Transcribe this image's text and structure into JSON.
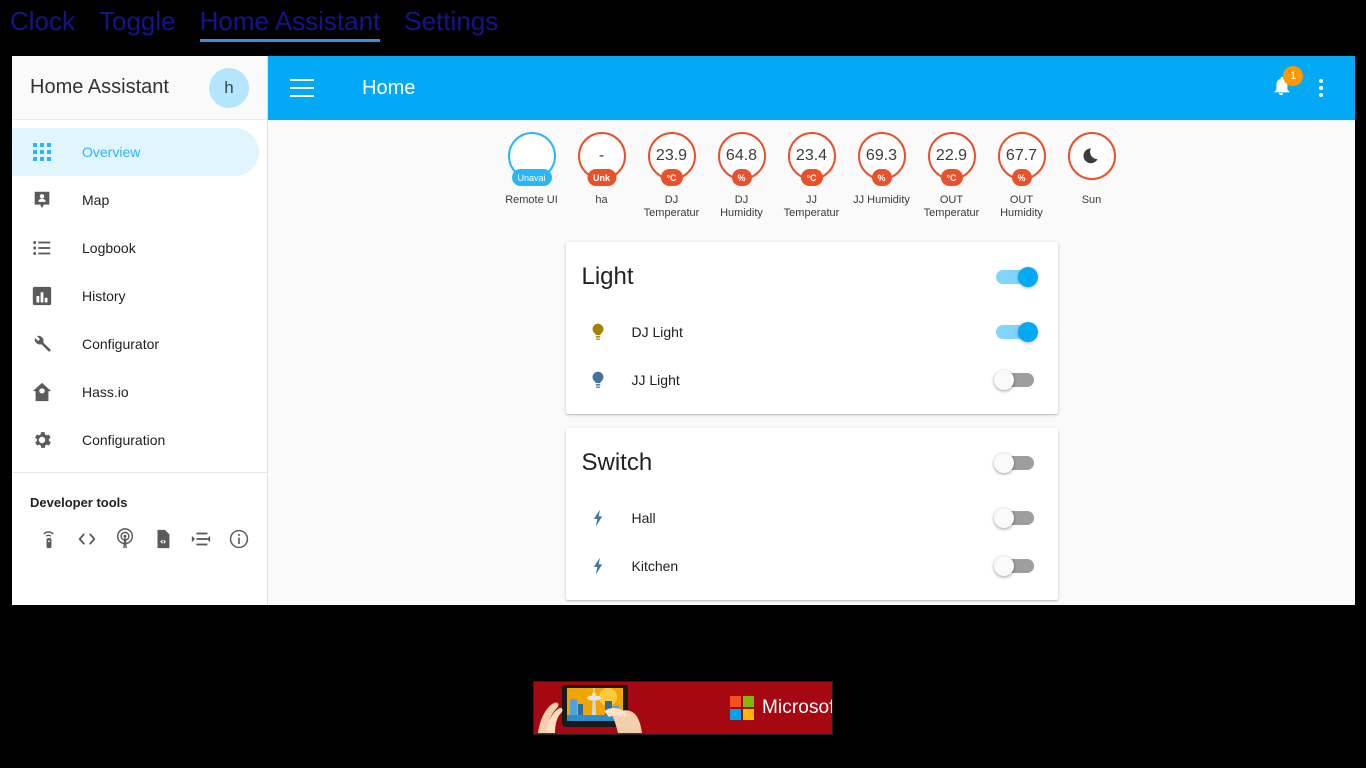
{
  "topnav": {
    "items": [
      {
        "label": "Clock",
        "active": false
      },
      {
        "label": "Toggle",
        "active": false
      },
      {
        "label": "Home Assistant",
        "active": true
      },
      {
        "label": "Settings",
        "active": false
      }
    ],
    "accent_underline": "#3d8fd6",
    "text_color": "#14148c"
  },
  "sidebar": {
    "title": "Home Assistant",
    "avatar_initial": "h",
    "items": [
      {
        "label": "Overview",
        "icon": "grid-icon",
        "active": true
      },
      {
        "label": "Map",
        "icon": "map-marker-icon",
        "active": false
      },
      {
        "label": "Logbook",
        "icon": "list-icon",
        "active": false
      },
      {
        "label": "History",
        "icon": "chart-bar-icon",
        "active": false
      },
      {
        "label": "Configurator",
        "icon": "wrench-icon",
        "active": false
      },
      {
        "label": "Hass.io",
        "icon": "home-leaf-icon",
        "active": false
      },
      {
        "label": "Configuration",
        "icon": "gear-icon",
        "active": false
      }
    ],
    "devtools_title": "Developer tools",
    "devtools_icons": [
      "remote-icon",
      "code-icon",
      "broadcast-icon",
      "template-file-icon",
      "services-icon",
      "info-icon"
    ]
  },
  "toolbar": {
    "menu_icon": "hamburger-icon",
    "title": "Home",
    "notification_icon": "bell-icon",
    "notification_count": "1",
    "notification_badge_color": "#ff9800",
    "overflow_icon": "kebab-menu-icon",
    "background": "#03a9f4"
  },
  "badges": [
    {
      "value": "",
      "pill": "Unavai",
      "label": "Remote UI",
      "color": "blue",
      "icon": ""
    },
    {
      "value": "-",
      "pill": "Unk",
      "label": "ha",
      "color": "orange",
      "icon": ""
    },
    {
      "value": "23.9",
      "pill": "°C",
      "label": "DJ Temperature",
      "color": "orange",
      "icon": ""
    },
    {
      "value": "64.8",
      "pill": "%",
      "label": "DJ Humidity",
      "color": "orange",
      "icon": ""
    },
    {
      "value": "23.4",
      "pill": "°C",
      "label": "JJ Temperature",
      "color": "orange",
      "icon": ""
    },
    {
      "value": "69.3",
      "pill": "%",
      "label": "JJ Humidity",
      "color": "orange",
      "icon": ""
    },
    {
      "value": "22.9",
      "pill": "°C",
      "label": "OUT Temperature",
      "color": "orange",
      "icon": ""
    },
    {
      "value": "67.7",
      "pill": "%",
      "label": "OUT Humidity",
      "color": "orange",
      "icon": ""
    },
    {
      "value": "",
      "pill": "",
      "label": "Sun",
      "color": "orange",
      "icon": "moon-icon"
    }
  ],
  "cards": [
    {
      "title": "Light",
      "master_on": true,
      "rows": [
        {
          "name": "DJ Light",
          "icon": "lightbulb-icon",
          "icon_color": "#a58100",
          "on": true
        },
        {
          "name": "JJ Light",
          "icon": "lightbulb-icon",
          "icon_color": "#44739e",
          "on": false
        }
      ]
    },
    {
      "title": "Switch",
      "master_on": false,
      "rows": [
        {
          "name": "Hall",
          "icon": "flash-icon",
          "icon_color": "#44739e",
          "on": false
        },
        {
          "name": "Kitchen",
          "icon": "flash-icon",
          "icon_color": "#44739e",
          "on": false
        }
      ]
    }
  ],
  "ad": {
    "brand": "Microsoft",
    "background": "#a50810",
    "logo_colors": [
      "#f25022",
      "#7fba00",
      "#00a4ef",
      "#ffb900"
    ],
    "art_description": "hands-holding-tablet-cityscape"
  }
}
